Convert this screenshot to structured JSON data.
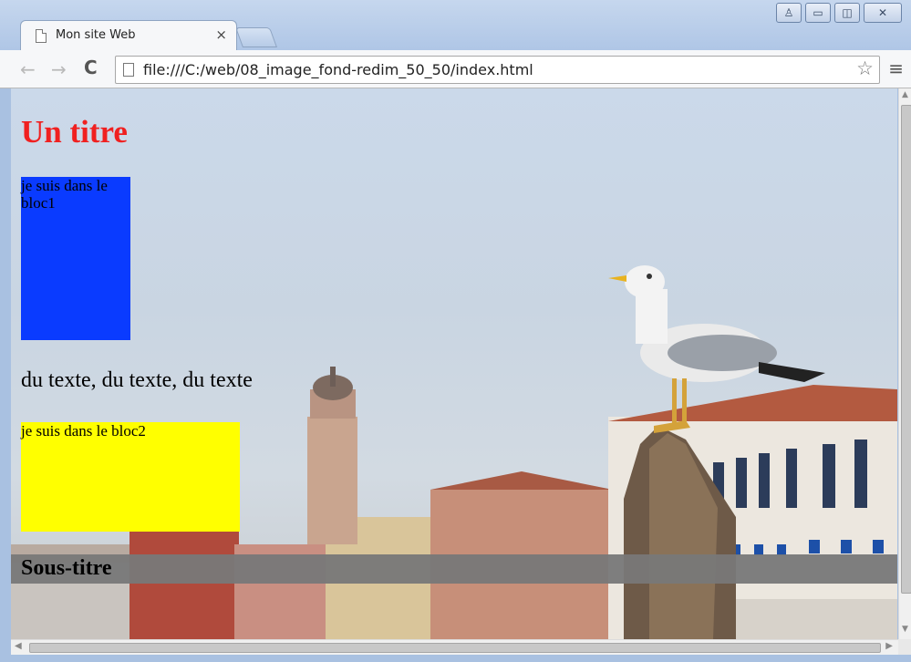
{
  "window": {
    "controls": {
      "user": "♙",
      "minimize": "▭",
      "maximize": "◫",
      "close": "✕"
    }
  },
  "tab": {
    "title": "Mon site Web",
    "close": "×"
  },
  "toolbar": {
    "back": "←",
    "forward": "→",
    "reload": "C",
    "url": "file:///C:/web/08_image_fond-redim_50_50/index.html",
    "star": "☆",
    "menu": "≡"
  },
  "page": {
    "title": "Un titre",
    "bloc1_text": "je suis dans le bloc1",
    "paragraph": "du texte, du texte, du texte",
    "bloc2_text": "je suis dans le bloc2",
    "subtitle": "Sous-titre"
  },
  "colors": {
    "title": "#f02020",
    "bloc1": "#0a3bff",
    "bloc2": "#ffff00",
    "subtitle_bar": "#787878"
  },
  "scrollbars": {
    "up": "▲",
    "down": "▼",
    "left": "◀",
    "right": "▶"
  }
}
